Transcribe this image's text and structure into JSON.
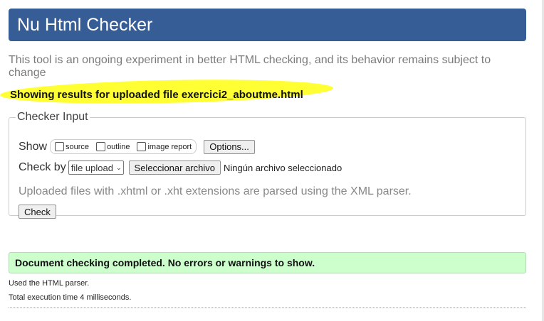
{
  "header": {
    "title": "Nu Html Checker"
  },
  "tagline": "This tool is an ongoing experiment in better HTML checking, and its behavior remains subject to change",
  "results_heading": "Showing results for uploaded file exercici2_aboutme.html",
  "checker_input": {
    "legend": "Checker Input",
    "show_label": "Show",
    "show_options": [
      "source",
      "outline",
      "image report"
    ],
    "options_button": "Options...",
    "check_by_label": "Check by",
    "check_by_value": "file upload",
    "file_button": "Seleccionar archivo",
    "no_file_text": "Ningún archivo seleccionado",
    "note": "Uploaded files with .xhtml or .xht extensions are parsed using the XML parser.",
    "check_button": "Check"
  },
  "success_message": "Document checking completed. No errors or warnings to show.",
  "footer": {
    "parser_line": "Used the HTML parser.",
    "time_line": "Total execution time 4 milliseconds."
  },
  "colors": {
    "header_bg": "#365d95",
    "highlight": "#ffff33",
    "success_bg": "#ccffcc"
  }
}
